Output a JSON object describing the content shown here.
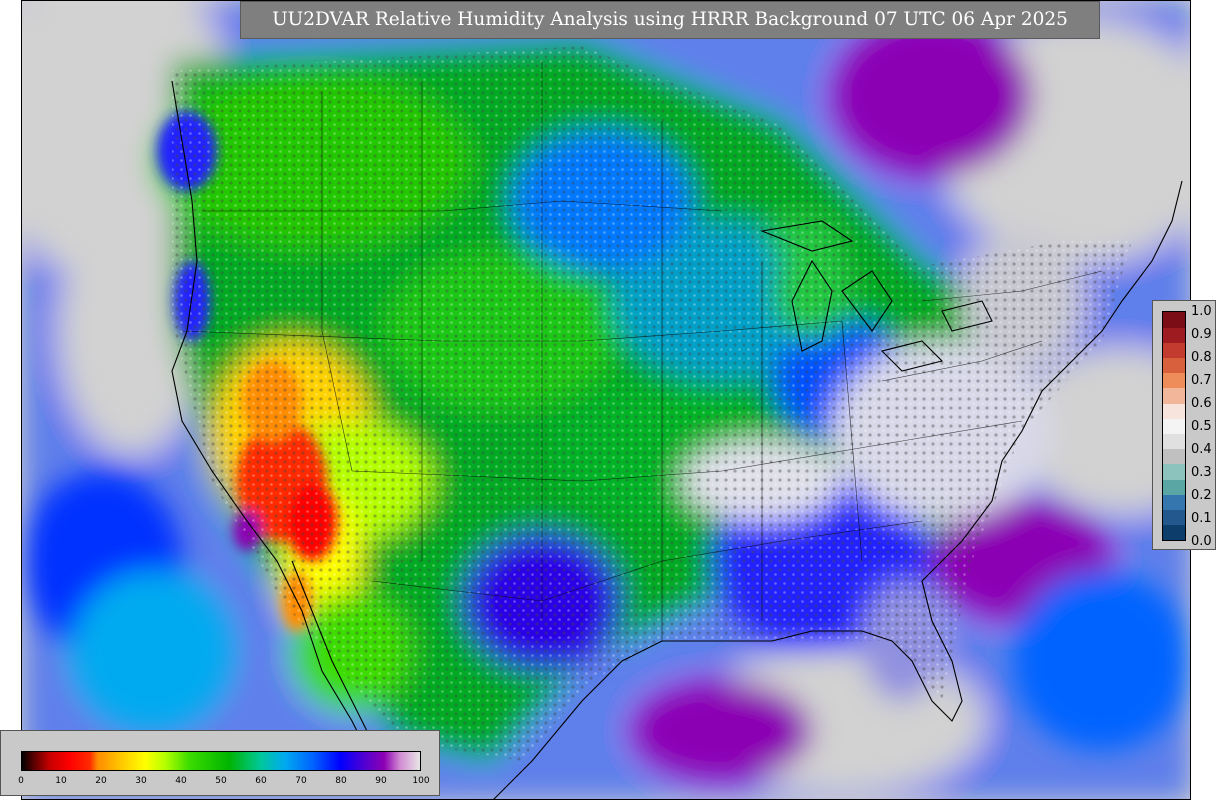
{
  "title": "UU2DVAR Relative Humidity Analysis using HRRR Background 07 UTC 06 Apr 2025",
  "colors": {
    "background_gray": "#d2d2d2",
    "title_box": "#7f7f7f",
    "legend_box": "#c9c9c9"
  },
  "rh_colorbar": {
    "ticks": [
      "0",
      "10",
      "20",
      "30",
      "40",
      "50",
      "60",
      "70",
      "80",
      "90",
      "100"
    ],
    "stops": [
      {
        "v": 0,
        "c": "#000000"
      },
      {
        "v": 3,
        "c": "#5a0000"
      },
      {
        "v": 7,
        "c": "#c80000"
      },
      {
        "v": 12,
        "c": "#ff0000"
      },
      {
        "v": 17,
        "c": "#ff2a00"
      },
      {
        "v": 19,
        "c": "#ff8c00"
      },
      {
        "v": 26,
        "c": "#ffd200"
      },
      {
        "v": 31,
        "c": "#ffff00"
      },
      {
        "v": 36,
        "c": "#b4ff00"
      },
      {
        "v": 42,
        "c": "#3cdc00"
      },
      {
        "v": 52,
        "c": "#00b400"
      },
      {
        "v": 60,
        "c": "#00c89b"
      },
      {
        "v": 66,
        "c": "#00aaf0"
      },
      {
        "v": 73,
        "c": "#0064ff"
      },
      {
        "v": 80,
        "c": "#0000ff"
      },
      {
        "v": 86,
        "c": "#5000d2"
      },
      {
        "v": 91,
        "c": "#8c00b4"
      },
      {
        "v": 95,
        "c": "#d28cd2"
      },
      {
        "v": 100,
        "c": "#e6e6e6"
      }
    ]
  },
  "obs_colorbar": {
    "ticks": [
      "1.0",
      "0.9",
      "0.8",
      "0.7",
      "0.6",
      "0.5",
      "0.4",
      "0.3",
      "0.2",
      "0.1",
      "0.0"
    ],
    "segments": [
      "#0d3d6b",
      "#23588f",
      "#3476ad",
      "#5aa6a5",
      "#8dc3bd",
      "#c0c0c0",
      "#e0e0e0",
      "#f4f4f4",
      "#f7e4dc",
      "#f2b79a",
      "#ee8c5a",
      "#d9603c",
      "#c23b2e",
      "#9e1b1f",
      "#7a0d16"
    ]
  }
}
